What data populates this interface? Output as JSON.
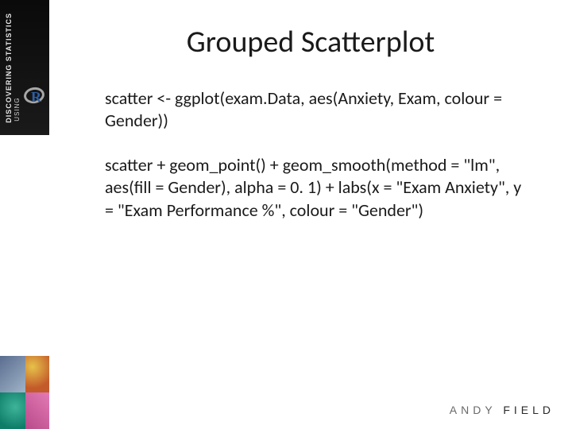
{
  "sidebar": {
    "spine_line1": "DISCOVERING STATISTICS",
    "spine_line2": "USING",
    "r_letter": "R"
  },
  "slide": {
    "title": "Grouped Scatterplot",
    "code1": "scatter <- ggplot(exam.Data, aes(Anxiety, Exam, colour = Gender))",
    "code2": "scatter + geom_point() + geom_smooth(method = \"lm\", aes(fill = Gender), alpha = 0. 1) + labs(x = \"Exam Anxiety\", y = \"Exam Performance %\", colour = \"Gender\")"
  },
  "footer": {
    "first": "ANDY",
    "last": "FIELD"
  }
}
